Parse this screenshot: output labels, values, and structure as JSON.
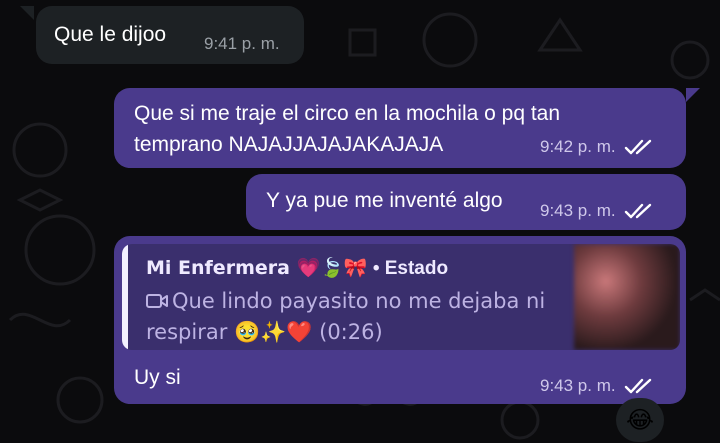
{
  "colors": {
    "background": "#0b0b0d",
    "incoming_bubble": "#1d2124",
    "outgoing_bubble": "#4a3a8c",
    "quote_background": "#3a2f6d",
    "tick_read": "#ffffff"
  },
  "messages": [
    {
      "direction": "incoming",
      "text": "Que le dijoo",
      "time": "9:41 p. m."
    },
    {
      "direction": "outgoing",
      "text": "Que si me traje el circo en la mochila o pq tan\ntemprano NAJAJJAJAJAKAJAJA",
      "time": "9:42 p. m.",
      "status_icon": "double-check-icon"
    },
    {
      "direction": "outgoing",
      "text": "Y ya pue me inventé algo",
      "time": "9:43 p. m.",
      "status_icon": "double-check-icon"
    },
    {
      "direction": "outgoing",
      "reply_to": {
        "author": "Mi Enfermera 💗🍃🎀",
        "source_label": "• Estado",
        "media_icon": "video-camera-icon",
        "text": "Que lindo payasito no me  dejaba ni respirar 🥹✨❤️ (0:26)",
        "thumbnail_icon": "blurred-video-thumbnail"
      },
      "text": "Uy si",
      "time": "9:43 p. m.",
      "status_icon": "double-check-icon",
      "reaction": "😂"
    }
  ]
}
